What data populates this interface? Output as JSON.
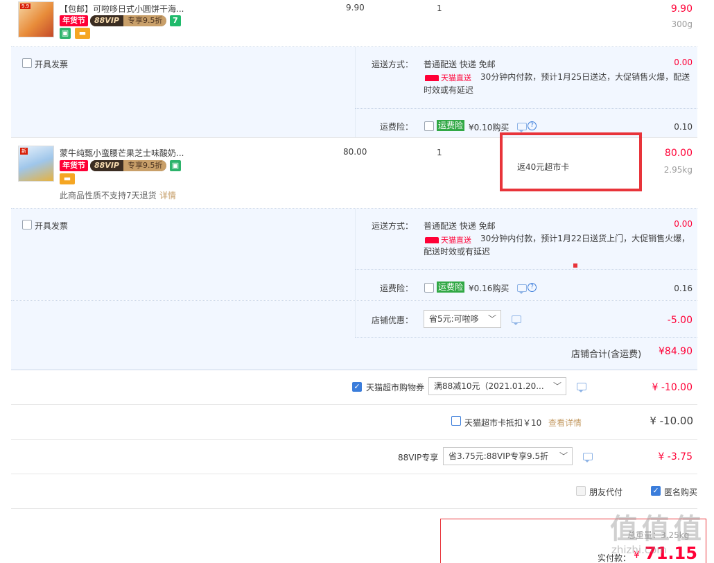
{
  "item1": {
    "name": "【包邮】可啦哆日式小圆饼干海...",
    "price": "9.90",
    "qty": "1",
    "subtotal": "9.90",
    "weight": "300g",
    "tag_festival": "年货节",
    "vip_a": "88VIP",
    "vip_b": "专享9.5折",
    "tag_seven": "7"
  },
  "shipping1": {
    "invoice_label": "开具发票",
    "method_label": "运送方式：",
    "method_value": "普通配送 快递 免邮",
    "fee": "0.00",
    "tmall_direct": "天猫直送",
    "note": "30分钟内付款，预计1月25日送达，大促销售火爆，配送时效或有延迟",
    "insurance_label": "运费险：",
    "insurance_badge": "运费险",
    "insurance_price": "¥0.10购买",
    "insurance_fee": "0.10"
  },
  "item2": {
    "name": "蒙牛纯甄小蛮腰芒果芝士味酸奶...",
    "price": "80.00",
    "qty": "1",
    "rebate": "返40元超市卡",
    "subtotal": "80.00",
    "weight": "2.95kg",
    "tag_festival": "年货节",
    "vip_a": "88VIP",
    "vip_b": "专享9.5折",
    "no_return": "此商品性质不支持7天退货",
    "detail_link": "详情"
  },
  "shipping2": {
    "invoice_label": "开具发票",
    "method_label": "运送方式：",
    "method_value": "普通配送 快递 免邮",
    "fee": "0.00",
    "tmall_direct": "天猫直送",
    "note": "30分钟内付款，预计1月22日送货上门，大促销售火爆，配送时效或有延迟",
    "insurance_label": "运费险：",
    "insurance_badge": "运费险",
    "insurance_price": "¥0.16购买",
    "insurance_fee": "0.16"
  },
  "shop": {
    "discount_label": "店铺优惠：",
    "discount_select": "省5元:可啦哆",
    "discount_value": "-5.00",
    "total_label": "店铺合计(含运费)",
    "total_value": "¥84.90"
  },
  "coupon": {
    "label": "天猫超市购物券",
    "select": "满88减10元（2021.01.20...",
    "value": "¥ -10.00"
  },
  "card": {
    "label": "天猫超市卡抵扣￥10",
    "link": "查看详情",
    "value": "¥ -10.00"
  },
  "vip": {
    "label": "88VIP专享",
    "select": "省3.75元:88VIP专享9.5折",
    "value": "¥ -3.75"
  },
  "options": {
    "friend_pay": "朋友代付",
    "anonymous": "匿名购买"
  },
  "footer": {
    "weight_label": "总重量：3.25kg",
    "pay_label": "实付款：",
    "currency": "¥",
    "pay_value": "71.15"
  },
  "watermark": {
    "logo": "值 值 值",
    "site": "zhizhi.com"
  },
  "colors": {
    "accent": "#ff0036",
    "highlight_box": "#e8343a",
    "section_bg": "#f2f7ff",
    "checkbox_blue": "#3b7ddb"
  }
}
